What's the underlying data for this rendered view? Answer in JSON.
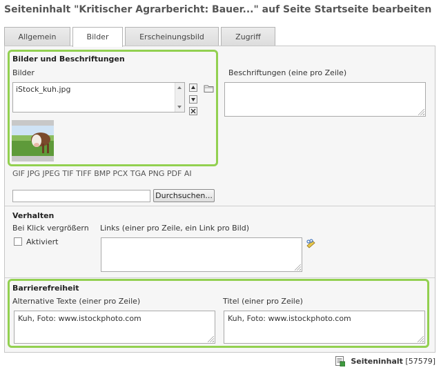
{
  "page": {
    "title": "Seiteninhalt \"Kritischer Agrarbericht: Bauer...\" auf Seite Startseite bearbeiten"
  },
  "tabs": [
    {
      "label": "Allgemein"
    },
    {
      "label": "Bilder"
    },
    {
      "label": "Erscheinungsbild"
    },
    {
      "label": "Zugriff"
    }
  ],
  "images_section": {
    "heading": "Bilder und Beschriftungen",
    "images_label": "Bilder",
    "files": [
      "iStock_kuh.jpg"
    ],
    "captions_label": "Beschriftungen (eine pro Zeile)",
    "captions_value": "",
    "allowed_types": "GIF JPG JPEG TIF TIFF BMP PCX TGA PNG PDF AI",
    "browse_label": "Durchsuchen..."
  },
  "behaviour_section": {
    "heading": "Verhalten",
    "zoom_label": "Bei Klick vergrößern",
    "activated_label": "Aktiviert",
    "activated_checked": false,
    "links_label": "Links (einer pro Zeile, ein Link pro Bild)",
    "links_value": ""
  },
  "accessibility_section": {
    "heading": "Barrierefreiheit",
    "alt_label": "Alternative Texte (einer pro Zeile)",
    "alt_value": "Kuh, Foto: www.istockphoto.com",
    "title_label": "Titel (einer pro Zeile)",
    "title_value": "Kuh, Foto: www.istockphoto.com"
  },
  "footer": {
    "record_type": "Seiteninhalt",
    "record_id": "[57579]"
  },
  "colors": {
    "highlight_frame": "#92d050"
  },
  "icons": {
    "move_up": "arrow-up-icon",
    "move_down": "arrow-down-icon",
    "remove": "remove-icon",
    "folder": "folder-icon",
    "link_wizard": "link-wizard-icon",
    "record": "content-record-icon"
  }
}
